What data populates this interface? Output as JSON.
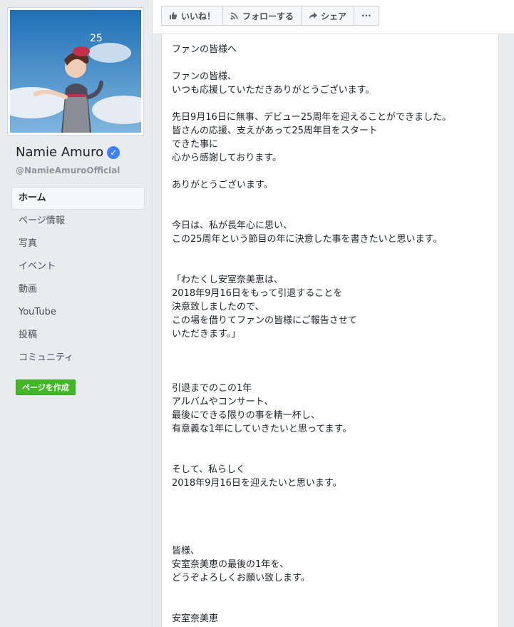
{
  "page": {
    "name": "Namie Amuro",
    "handle": "@NamieAmuroOfficial",
    "verified_icon": "verified-check-icon"
  },
  "nav": {
    "items": [
      "ホーム",
      "ページ情報",
      "写真",
      "イベント",
      "動画",
      "YouTube",
      "投稿",
      "コミュニティ"
    ],
    "active_index": 0
  },
  "create_page_label": "ページを作成",
  "actions": [
    {
      "label": "いいね！",
      "icon": "thumbs-up-icon"
    },
    {
      "label": "フォローする",
      "icon": "rss-icon"
    },
    {
      "label": "シェア",
      "icon": "share-arrow-icon"
    },
    {
      "label": "···",
      "icon": "more-dots-icon"
    }
  ],
  "post": {
    "text": "ファンの皆様へ\n\nファンの皆様、\nいつも応援していただきありがとうございます。\n\n先日9月16日に無事、デビュー25周年を迎えることができました。\n皆さんの応援、支えがあって25周年目をスタート\nできた事に\n心から感謝しております。\n\nありがとうございます。\n\n\n今日は、私が長年心に思い、\nこの25周年という節目の年に決意した事を書きたいと思います。\n\n\n「わたくし安室奈美恵は、\n  2018年9月16日をもって引退することを\n  決意致しましたので、\n  この場を借りてファンの皆様にご報告させて\n  いただきます。」\n\n\n\n引退までのこの1年\nアルバムやコンサート、\n最後にできる限りの事を精一杯し、\n有意義な1年にしていきたいと思ってます。\n\n\nそして、私らしく\n2018年9月16日を迎えたいと思います。\n\n\n\n\n皆様、\n安室奈美恵の最後の1年を、\nどうぞよろしくお願い致します。\n\n\n安室奈美恵"
  },
  "colors": {
    "accent": "#4080ff",
    "create_button": "#42b72a"
  }
}
